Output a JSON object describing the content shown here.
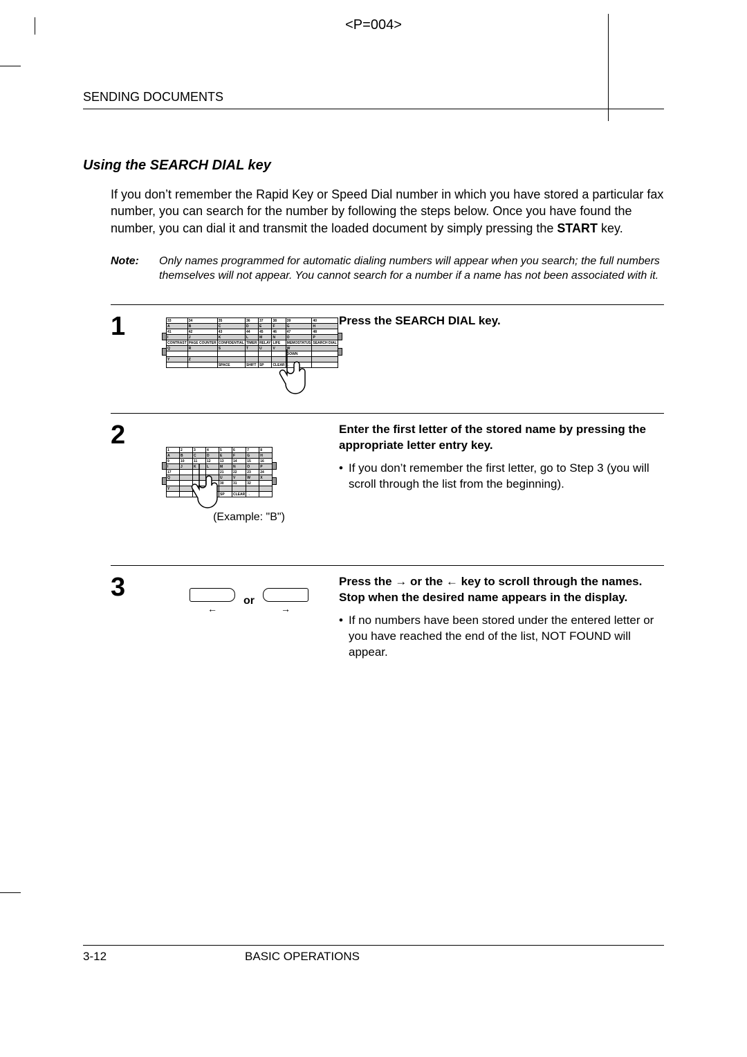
{
  "page_code": "<P=004>",
  "section_header": "SENDING DOCUMENTS",
  "subtitle": "Using the SEARCH DIAL key",
  "intro_html": "If you don’t remember the Rapid Key or Speed Dial number in which you have stored a particular fax number, you can search for the number by following the steps below. Once you have found the number, you can dial it and transmit the loaded document by simply pressing the <b>START</b> key.",
  "note_label": "Note:",
  "note_text": "Only names programmed for automatic dialing numbers will appear when you search; the full numbers themselves will not appear. You cannot search for a number if a name has not been associated with it.",
  "steps": [
    {
      "num": "1",
      "lead": "Press the SEARCH DIAL key.",
      "bullets": [],
      "example": "",
      "graphic": "keypad1"
    },
    {
      "num": "2",
      "lead": "Enter the first letter of the stored name by pressing the appropriate letter entry key.",
      "bullets": [
        "If you don’t remember the first letter, go to Step 3 (you will scroll through the list from the beginning)."
      ],
      "example": "(Example: \"B\")",
      "graphic": "keypad2"
    },
    {
      "num": "3",
      "lead_html": "Press the → or the ← key to scroll through the names. Stop when the desired name appears in the display.",
      "bullets": [
        "If no numbers have been stored under the entered letter or you have reached the end of the list, NOT FOUND will appear."
      ],
      "example": "",
      "graphic": "scroll",
      "or_label": "or"
    }
  ],
  "keypad1_rows": [
    [
      "33",
      "34",
      "35",
      "36",
      "37",
      "38",
      "39",
      "40"
    ],
    [
      "A",
      "B",
      "C",
      "D",
      "E",
      "F",
      "G",
      "H"
    ],
    [
      "41",
      "42",
      "43",
      "44",
      "45",
      "46",
      "47",
      "48"
    ],
    [
      "I",
      "J",
      "K",
      "L",
      "M",
      "N",
      "O",
      "P"
    ],
    [
      "CONTRAST",
      "PAGE COUNTER",
      "CONFIDENTIAL",
      "TIMER",
      "RELAY",
      "LIFE",
      "MEMOSTATUS",
      "SEARCH DIAL"
    ],
    [
      "Q",
      "R",
      "S",
      "T",
      "U",
      "V",
      "W",
      ""
    ],
    [
      "",
      "",
      "",
      "",
      "",
      "",
      "DOWN",
      ""
    ],
    [
      "Y",
      "Z",
      "",
      "",
      "",
      "",
      "",
      ""
    ],
    [
      "",
      "",
      "SPACE",
      "SHIFT",
      "SP",
      "CLEAR",
      "←",
      ""
    ]
  ],
  "keypad2_rows": [
    [
      "1",
      "2",
      "3",
      "4",
      "5",
      "6",
      "7",
      "8"
    ],
    [
      "A",
      "B",
      "C",
      "D",
      "E",
      "F",
      "G",
      "H"
    ],
    [
      "9",
      "10",
      "11",
      "12",
      "13",
      "14",
      "15",
      "16"
    ],
    [
      "I",
      "J",
      "K",
      "L",
      "M",
      "N",
      "O",
      "P"
    ],
    [
      "17",
      "",
      "",
      "",
      "21",
      "22",
      "23",
      "24"
    ],
    [
      "Q",
      "",
      "",
      "",
      "U",
      "V",
      "W",
      "X"
    ],
    [
      "",
      "",
      "",
      "29",
      "30",
      "31",
      "32",
      ""
    ],
    [
      "Y",
      "",
      "",
      "",
      "",
      "",
      "",
      ""
    ],
    [
      "",
      "",
      "",
      "SHIFT",
      "SP",
      "CLEAR",
      "→",
      ""
    ]
  ],
  "footer_page": "3-12",
  "footer_title": "BASIC OPERATIONS"
}
